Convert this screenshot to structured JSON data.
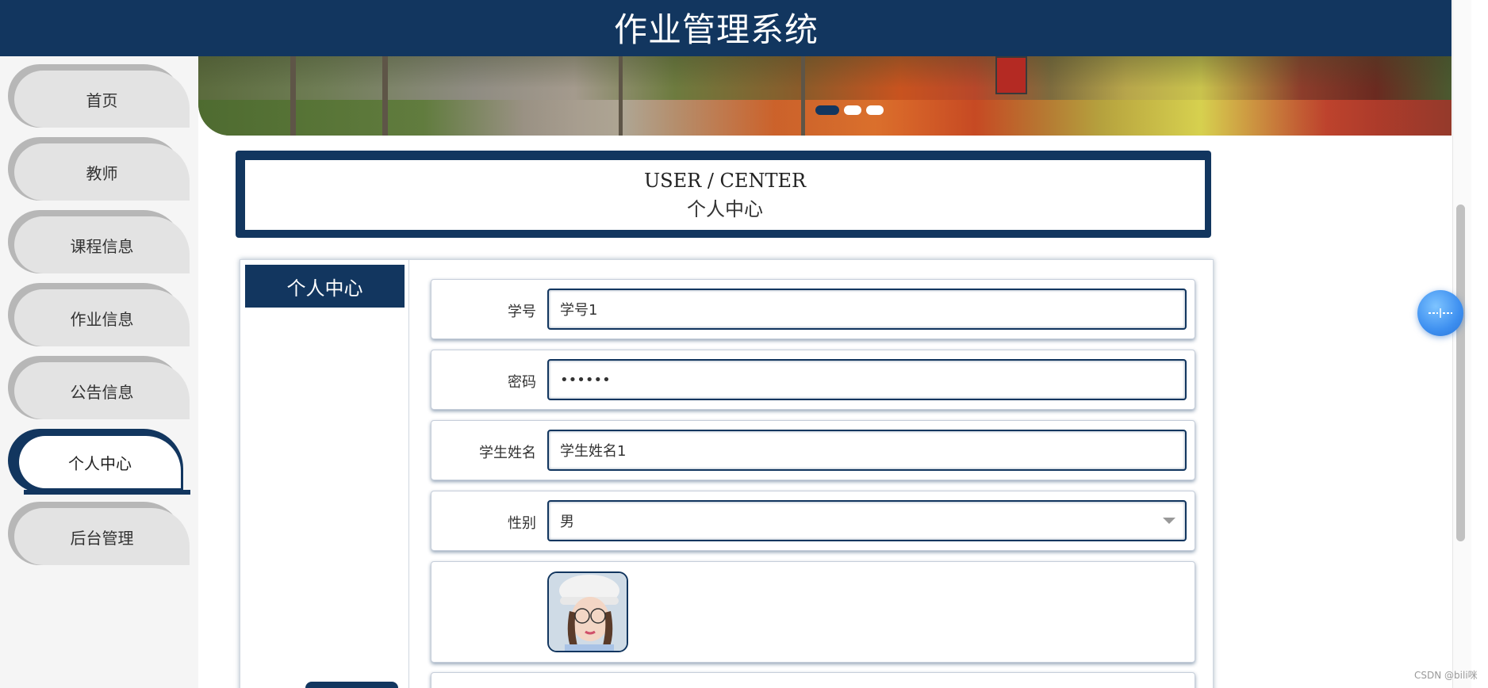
{
  "header": {
    "title": "作业管理系统"
  },
  "sidebar": {
    "items": [
      {
        "label": "首页",
        "active": false
      },
      {
        "label": "教师",
        "active": false
      },
      {
        "label": "课程信息",
        "active": false
      },
      {
        "label": "作业信息",
        "active": false
      },
      {
        "label": "公告信息",
        "active": false
      },
      {
        "label": "个人中心",
        "active": true
      },
      {
        "label": "后台管理",
        "active": false
      }
    ]
  },
  "banner": {
    "slide_count": 3,
    "active_slide": 1
  },
  "title_card": {
    "english": "USER / CENTER",
    "chinese": "个人中心"
  },
  "content": {
    "side_tab": "个人中心",
    "form": {
      "student_id_label": "学号",
      "student_id_value": "学号1",
      "password_label": "密码",
      "password_value": "••••••",
      "name_label": "学生姓名",
      "name_value": "学生姓名1",
      "gender_label": "性别",
      "gender_value": "男"
    }
  },
  "fab": {
    "icon": "customer-service-icon"
  },
  "watermark": "CSDN @bili咪",
  "colors": {
    "primary": "#12365f",
    "sidebar_bg": "#f5f5f5",
    "pill": "#e3e3e3"
  }
}
